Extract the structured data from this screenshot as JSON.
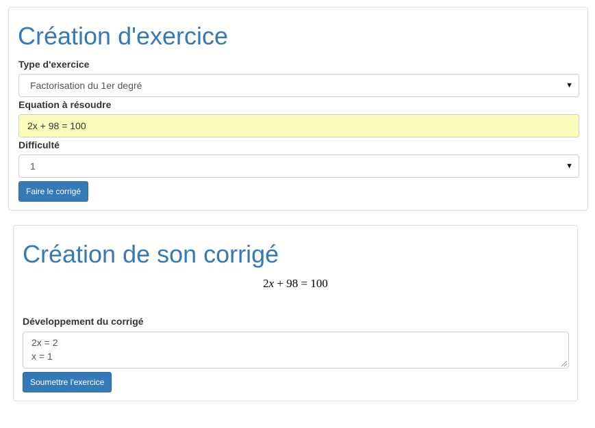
{
  "exercise_panel": {
    "title": "Création d'exercice",
    "type_label": "Type d'exercice",
    "type_selected": "Factorisation du 1er degré",
    "equation_label": "Equation à résoudre",
    "equation_value": "2x + 98 = 100",
    "difficulty_label": "Difficulté",
    "difficulty_selected": "1",
    "submit_label": "Faire le corrigé"
  },
  "correction_panel": {
    "title": "Création de son corrigé",
    "equation_rendered": {
      "coef": "2",
      "var": "x",
      "rest": " + 98 = 100"
    },
    "development_label": "Développement du corrigé",
    "development_lines": [
      "2x = 2",
      "x = 1"
    ],
    "submit_label": "Soumettre l'exercice"
  }
}
